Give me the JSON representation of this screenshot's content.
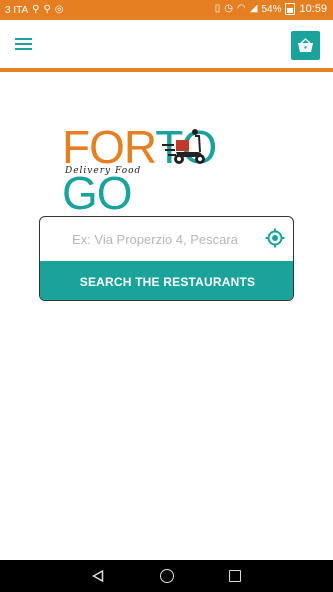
{
  "status_bar": {
    "carrier": "3 ITA",
    "battery": "54%",
    "time": "10:59"
  },
  "app_bar": {
    "menu_icon": "hamburger-icon",
    "cart_icon": "basket-icon"
  },
  "logo": {
    "text_for": "FOR",
    "text_to": "TO",
    "text_go": "GO",
    "subtitle": "Delivery Food"
  },
  "search": {
    "placeholder": "Ex: Via Properzio 4, Pescara",
    "value": "",
    "locate_icon": "gps-target-icon",
    "button_label": "SEARCH THE RESTAURANTS"
  },
  "colors": {
    "orange": "#e67e22",
    "teal": "#1aa39a"
  },
  "nav_bar": {
    "back_icon": "back-triangle-icon",
    "home_icon": "home-circle-icon",
    "recent_icon": "recent-square-icon"
  }
}
